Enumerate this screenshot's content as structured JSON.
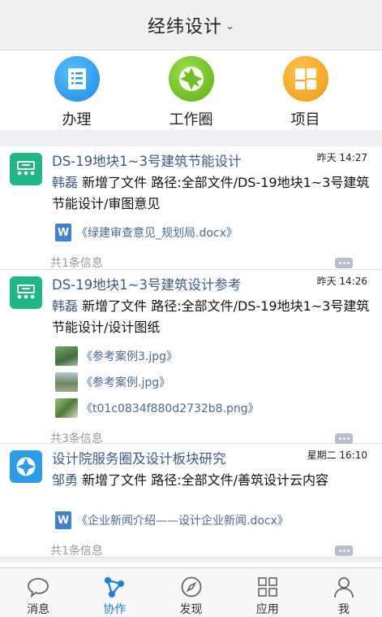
{
  "header": {
    "title": "经纬设计",
    "chevron": "⌄"
  },
  "quick_actions": [
    {
      "label": "办理",
      "icon": "document-list-icon",
      "color": "#2a9be8"
    },
    {
      "label": "工作圈",
      "icon": "aperture-icon",
      "color": "#6cc11c"
    },
    {
      "label": "项目",
      "icon": "grid-blocks-icon",
      "color": "#f5a623"
    }
  ],
  "feed": [
    {
      "title": "DS-19地块1~3号建筑节能设计",
      "time": "昨天 14:27",
      "user": "韩磊",
      "text": " 新增了文件 路径:全部文件/DS-19地块1~3号建筑节能设计/审图意见",
      "attachments": [
        "《绿建审查意见_规划局.docx》"
      ],
      "footer": "共1条信息"
    },
    {
      "title": "DS-19地块1~3号建筑设计参考",
      "time": "昨天 14:26",
      "user": "韩磊",
      "text": " 新增了文件 路径:全部文件/DS-19地块1~3号建筑节能设计/设计图纸",
      "attachments": [
        "《参考案例3.jpg》",
        "《参考案例.jpg》",
        "《t01c0834f880d2732b8.png》"
      ],
      "footer": "共3条信息"
    },
    {
      "title": "设计院服务圈及设计板块研究",
      "time": "星期二 16:10",
      "user": "邹勇",
      "text": " 新增了文件 路径:全部文件/善筑设计云内容",
      "attachments": [
        "《企业新闻介绍——设计企业新闻.docx》"
      ],
      "footer": "共1条信息"
    }
  ],
  "tabbar": [
    {
      "label": "消息",
      "icon": "chat-bubble-icon"
    },
    {
      "label": "协作",
      "icon": "collaboration-icon",
      "active": true
    },
    {
      "label": "发现",
      "icon": "compass-icon"
    },
    {
      "label": "应用",
      "icon": "apps-grid-icon"
    },
    {
      "label": "我",
      "icon": "person-icon"
    }
  ]
}
